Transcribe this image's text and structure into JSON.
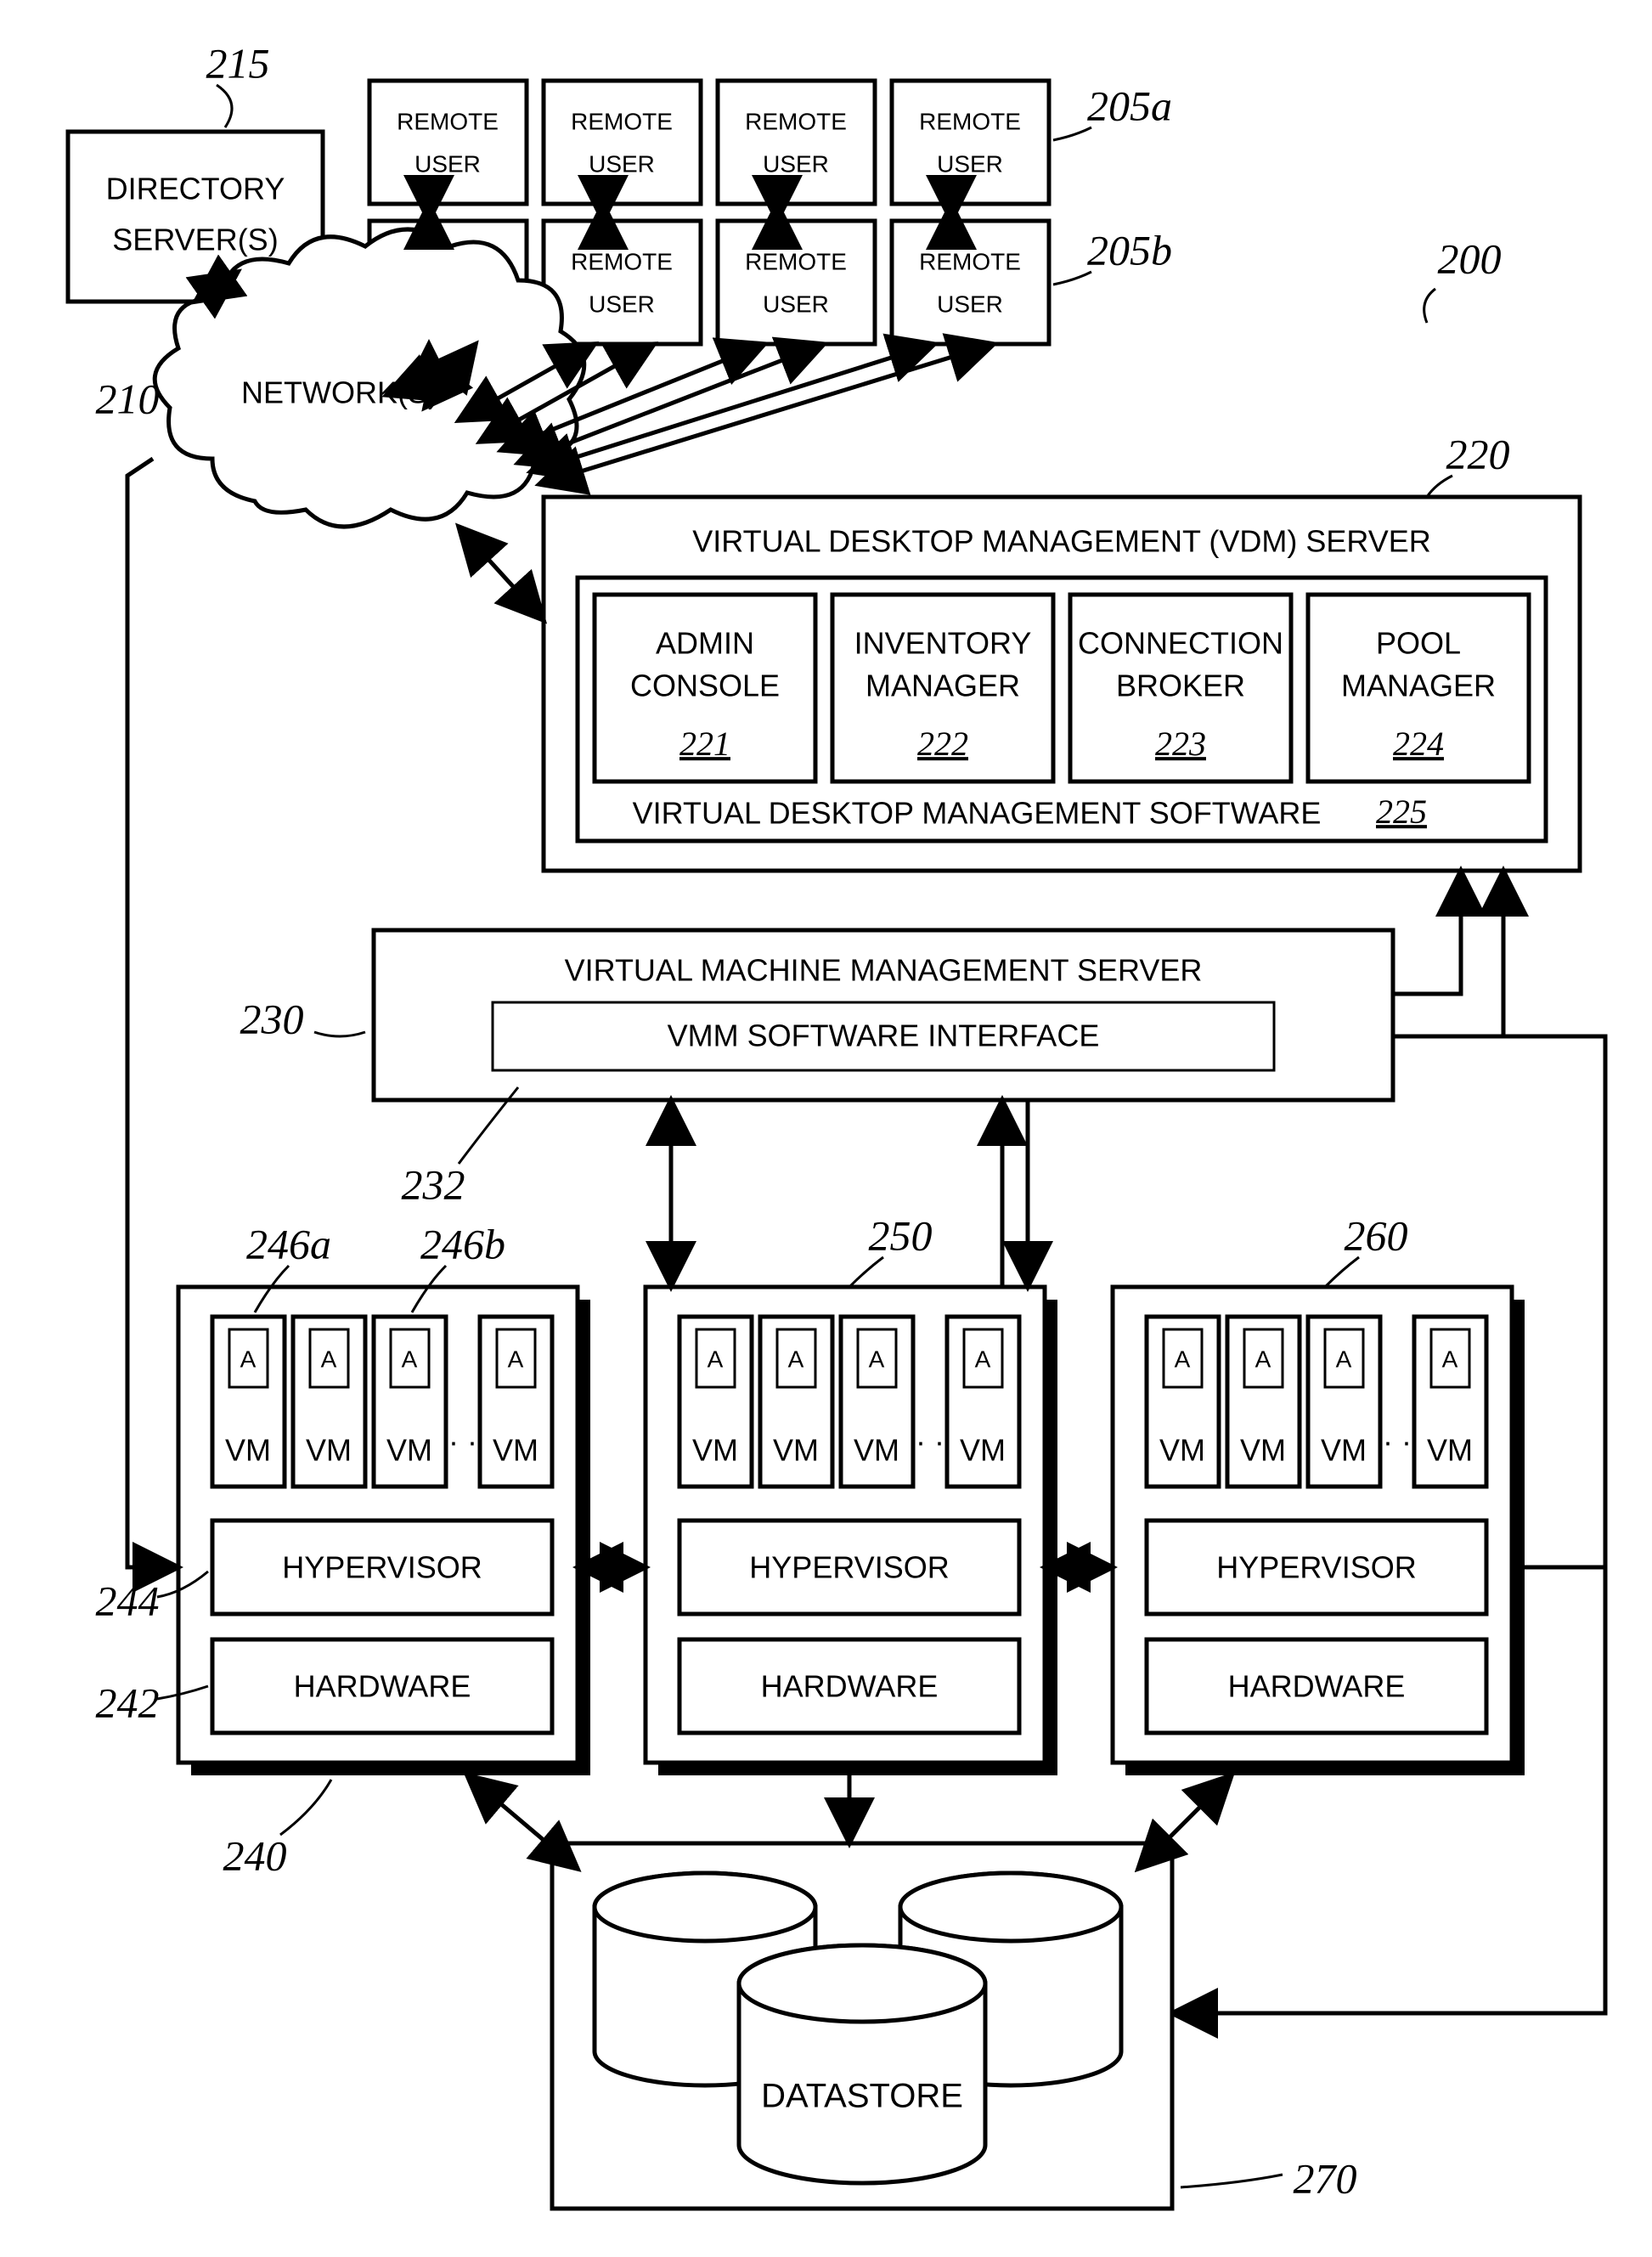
{
  "refs": {
    "r200": "200",
    "r205a": "205a",
    "r205b": "205b",
    "r210": "210",
    "r215": "215",
    "r220": "220",
    "r221": "221",
    "r222": "222",
    "r223": "223",
    "r224": "224",
    "r225": "225",
    "r230": "230",
    "r232": "232",
    "r240": "240",
    "r242": "242",
    "r244": "244",
    "r246a": "246a",
    "r246b": "246b",
    "r250": "250",
    "r260": "260",
    "r270": "270"
  },
  "labels": {
    "directory1": "DIRECTORY",
    "directory2": "SERVER(S)",
    "remote1": "REMOTE",
    "remote2": "USER",
    "network": "NETWORK(S)",
    "vdm_title": "VIRTUAL DESKTOP MANAGEMENT (VDM) SERVER",
    "admin1": "ADMIN",
    "admin2": "CONSOLE",
    "inv1": "INVENTORY",
    "inv2": "MANAGER",
    "conn1": "CONNECTION",
    "conn2": "BROKER",
    "pool1": "POOL",
    "pool2": "MANAGER",
    "vdm_sw": "VIRTUAL DESKTOP MANAGEMENT SOFTWARE",
    "vmm_title": "VIRTUAL MACHINE MANAGEMENT SERVER",
    "vmm_if": "VMM SOFTWARE INTERFACE",
    "A": "A",
    "VM": "VM",
    "ellipsis": "· ·",
    "hypervisor": "HYPERVISOR",
    "hardware": "HARDWARE",
    "datastore": "DATASTORE"
  }
}
